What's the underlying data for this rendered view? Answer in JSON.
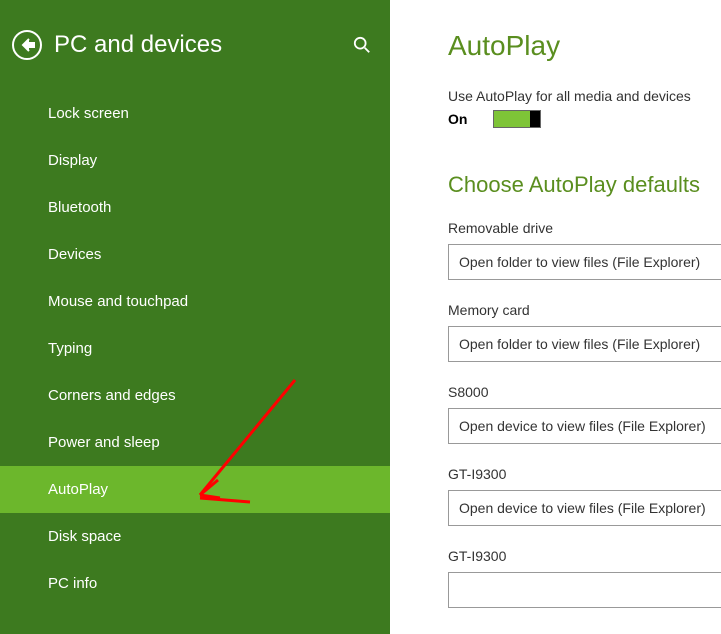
{
  "sidebar": {
    "title": "PC and devices",
    "items": [
      {
        "label": "Lock screen",
        "selected": false
      },
      {
        "label": "Display",
        "selected": false
      },
      {
        "label": "Bluetooth",
        "selected": false
      },
      {
        "label": "Devices",
        "selected": false
      },
      {
        "label": "Mouse and touchpad",
        "selected": false
      },
      {
        "label": "Typing",
        "selected": false
      },
      {
        "label": "Corners and edges",
        "selected": false
      },
      {
        "label": "Power and sleep",
        "selected": false
      },
      {
        "label": "AutoPlay",
        "selected": true
      },
      {
        "label": "Disk space",
        "selected": false
      },
      {
        "label": "PC info",
        "selected": false
      }
    ]
  },
  "content": {
    "title": "AutoPlay",
    "toggle_label": "Use AutoPlay for all media and devices",
    "toggle_state": "On",
    "section_title": "Choose AutoPlay defaults",
    "settings": [
      {
        "label": "Removable drive",
        "value": "Open folder to view files (File Explorer)"
      },
      {
        "label": "Memory card",
        "value": "Open folder to view files (File Explorer)"
      },
      {
        "label": "S8000",
        "value": "Open device to view files (File Explorer)"
      },
      {
        "label": "GT-I9300",
        "value": "Open device to view files (File Explorer)"
      },
      {
        "label": "GT-I9300",
        "value": ""
      }
    ]
  },
  "colors": {
    "sidebar_bg": "#3d7a1f",
    "selected_bg": "#6cb72c",
    "accent": "#5a8e1f",
    "arrow": "#ff0000"
  }
}
